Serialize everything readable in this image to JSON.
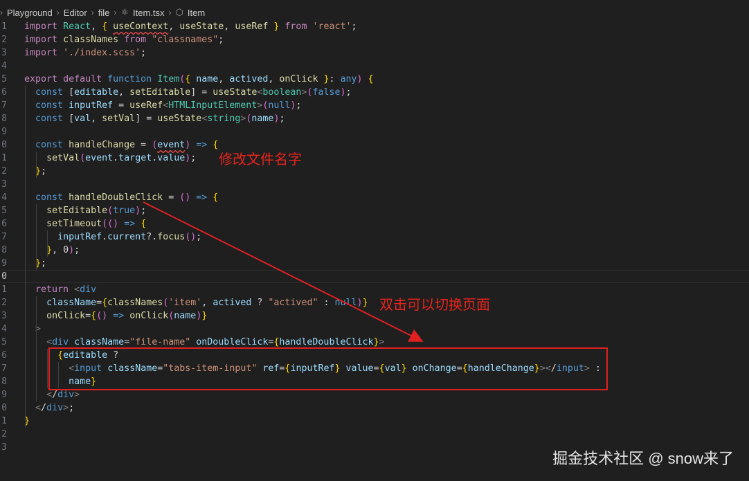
{
  "breadcrumb": {
    "items": [
      "Playground",
      "Editor",
      "file",
      "Item.tsx",
      "Item"
    ]
  },
  "editor": {
    "line_numbers": [
      "1",
      "2",
      "3",
      "4",
      "5",
      "6",
      "7",
      "8",
      "9",
      "0",
      "1",
      "2",
      "3",
      "4",
      "5",
      "6",
      "7",
      "8",
      "9",
      "0",
      "1",
      "2",
      "3",
      "4",
      "5",
      "6",
      "7",
      "8",
      "9",
      "0",
      "1",
      "2",
      "3"
    ],
    "lines": [
      "import React, { useContext, useState, useRef } from 'react';",
      "import classNames from \"classnames\";",
      "import './index.scss';",
      "",
      "export default function Item({ name, actived, onClick }: any) {",
      "  const [editable, setEditable] = useState<boolean>(false);",
      "  const inputRef = useRef<HTMLInputElement>(null);",
      "  const [val, setVal] = useState<string>(name);",
      "",
      "  const handleChange = (event) => {",
      "    setVal(event.target.value);",
      "  };",
      "",
      "  const handleDoubleClick = () => {",
      "    setEditable(true);",
      "    setTimeout(() => {",
      "      inputRef.current?.focus();",
      "    }, 0);",
      "  };",
      "",
      "  return <div",
      "    className={classNames('item', actived ? \"actived\" : null)}",
      "    onClick={() => onClick(name)}",
      "  >",
      "    <div className=\"file-name\" onDoubleClick={handleDoubleClick}>",
      "      {editable ?",
      "        <input className=\"tabs-item-input\" ref={inputRef} value={val} onChange={handleChange}></input> :",
      "        name}",
      "    </div>",
      "  </div>;",
      "}",
      "",
      ""
    ]
  },
  "annotations": {
    "rename_note": "修改文件名字",
    "double_click_note": "双击可以切换页面"
  },
  "watermark": "掘金技术社区 @ snow来了",
  "colors": {
    "background": "#1f1f1f",
    "annotation_red": "#e02020"
  }
}
